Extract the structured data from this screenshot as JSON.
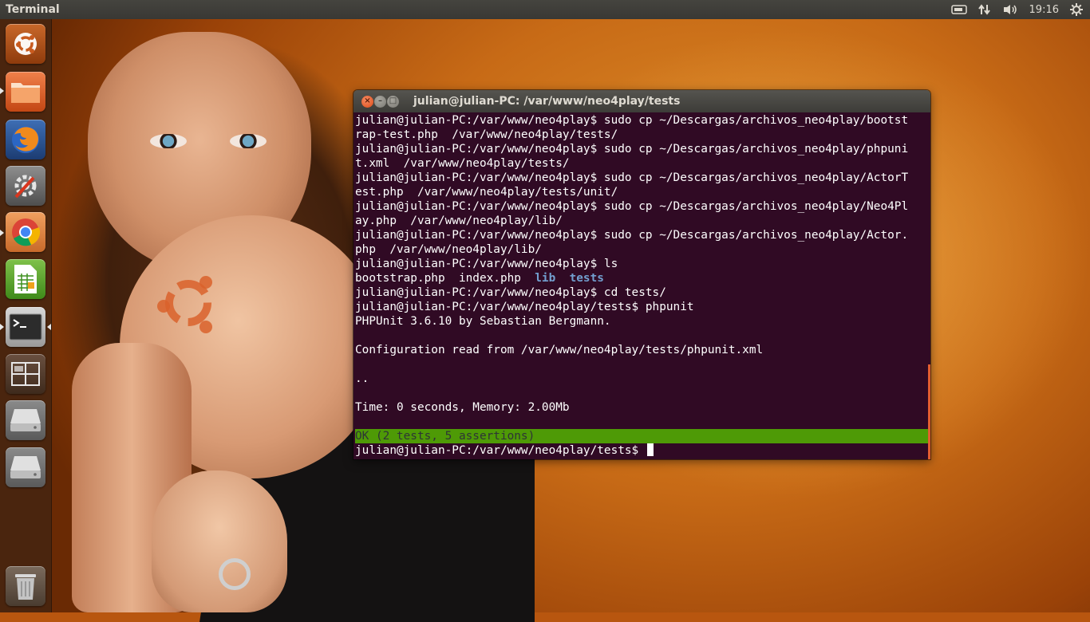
{
  "top_panel": {
    "app_title": "Terminal",
    "clock": "19:16"
  },
  "launcher": {
    "items": [
      {
        "name": "dash-home",
        "icon": "ubuntu-logo-icon"
      },
      {
        "name": "files",
        "icon": "folder-icon"
      },
      {
        "name": "firefox",
        "icon": "firefox-icon"
      },
      {
        "name": "system-settings",
        "icon": "settings-tools-icon"
      },
      {
        "name": "chromium",
        "icon": "chrome-icon"
      },
      {
        "name": "libreoffice-calc",
        "icon": "spreadsheet-icon"
      },
      {
        "name": "terminal",
        "icon": "terminal-icon"
      },
      {
        "name": "workspace-switcher",
        "icon": "workspaces-icon"
      },
      {
        "name": "drive-1",
        "icon": "hard-drive-icon"
      },
      {
        "name": "drive-2",
        "icon": "hard-drive-icon"
      },
      {
        "name": "trash",
        "icon": "trash-icon"
      }
    ]
  },
  "terminal": {
    "title": "julian@julian-PC: /var/www/neo4play/tests",
    "lines": [
      "julian@julian-PC:/var/www/neo4play$ sudo cp ~/Descargas/archivos_neo4play/bootst",
      "rap-test.php  /var/www/neo4play/tests/",
      "julian@julian-PC:/var/www/neo4play$ sudo cp ~/Descargas/archivos_neo4play/phpuni",
      "t.xml  /var/www/neo4play/tests/",
      "julian@julian-PC:/var/www/neo4play$ sudo cp ~/Descargas/archivos_neo4play/ActorT",
      "est.php  /var/www/neo4play/tests/unit/",
      "julian@julian-PC:/var/www/neo4play$ sudo cp ~/Descargas/archivos_neo4play/Neo4Pl",
      "ay.php  /var/www/neo4play/lib/",
      "julian@julian-PC:/var/www/neo4play$ sudo cp ~/Descargas/archivos_neo4play/Actor.",
      "php  /var/www/neo4play/lib/",
      "julian@julian-PC:/var/www/neo4play$ ls"
    ],
    "ls_files": "bootstrap.php  index.php  ",
    "ls_dir_1": "lib",
    "ls_dir_2": "tests",
    "lines_after_ls": [
      "julian@julian-PC:/var/www/neo4play$ cd tests/",
      "julian@julian-PC:/var/www/neo4play/tests$ phpunit",
      "PHPUnit 3.6.10 by Sebastian Bergmann.",
      "",
      "Configuration read from /var/www/neo4play/tests/phpunit.xml",
      "",
      "..",
      "",
      "Time: 0 seconds, Memory: 2.00Mb",
      ""
    ],
    "ok_line": "OK (2 tests, 5 assertions)",
    "prompt": "julian@julian-PC:/var/www/neo4play/tests$ "
  },
  "colors": {
    "terminal_bg": "#300a24",
    "ok_bg": "#4e9a06",
    "dir_color": "#729fcf",
    "scrollbar": "#e35d2f"
  }
}
